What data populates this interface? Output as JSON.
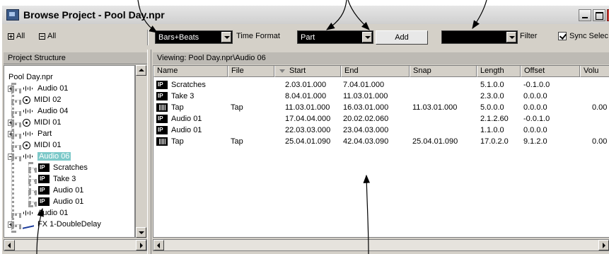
{
  "window": {
    "title": "Browse Project - Pool Day.npr"
  },
  "toolbar": {
    "expand_all": "All",
    "collapse_all": "All",
    "time_format_value": "Bars+Beats",
    "time_format_label": "Time Format",
    "type_value": "Part",
    "add_label": "Add",
    "filter_value": "",
    "filter_label": "Filter",
    "sync_label": "Sync Selec"
  },
  "left_panel": {
    "header": "Project Structure",
    "tree": [
      {
        "label": "Pool Day.npr",
        "icon": "",
        "depth": 0,
        "expander": "",
        "selected": false
      },
      {
        "label": "Audio 01",
        "icon": "audio-waveform-icon",
        "depth": 1,
        "expander": "plus",
        "selected": false
      },
      {
        "label": "MIDI 02",
        "icon": "midi-icon",
        "depth": 1,
        "expander": "",
        "selected": false
      },
      {
        "label": "Audio 04",
        "icon": "audio-waveform-icon",
        "depth": 1,
        "expander": "",
        "selected": false
      },
      {
        "label": "MIDI 01",
        "icon": "midi-icon",
        "depth": 1,
        "expander": "plus",
        "selected": false
      },
      {
        "label": "Part",
        "icon": "audio-waveform-icon",
        "depth": 1,
        "expander": "plus",
        "selected": false
      },
      {
        "label": "MIDI 01",
        "icon": "midi-icon",
        "depth": 1,
        "expander": "",
        "selected": false
      },
      {
        "label": "Audio 06",
        "icon": "audio-waveform-icon",
        "depth": 1,
        "expander": "minus",
        "selected": true
      },
      {
        "label": "Scratches",
        "icon": "audio-event-icon",
        "depth": 2,
        "expander": "",
        "selected": false
      },
      {
        "label": "Take 3",
        "icon": "audio-event-icon",
        "depth": 2,
        "expander": "",
        "selected": false
      },
      {
        "label": "Audio 01",
        "icon": "audio-event-icon",
        "depth": 2,
        "expander": "",
        "selected": false
      },
      {
        "label": "Audio 01",
        "icon": "audio-event-icon",
        "depth": 2,
        "expander": "",
        "selected": false
      },
      {
        "label": "Audio 01",
        "icon": "audio-waveform-icon",
        "depth": 1,
        "expander": "",
        "selected": false
      },
      {
        "label": "FX 1-DoubleDelay",
        "icon": "fx-curve-icon",
        "depth": 1,
        "expander": "plus",
        "selected": false
      }
    ]
  },
  "right_panel": {
    "viewing": "Viewing: Pool Day.npr\\Audio 06",
    "columns": [
      "Name",
      "File",
      "Start",
      "End",
      "Snap",
      "Length",
      "Offset",
      "Volu"
    ],
    "rows": [
      {
        "icon": "audio-event-icon",
        "name": "Scratches",
        "file": "",
        "start": "2.03.01.000",
        "end": "7.04.01.000",
        "snap": "",
        "length": "5.1.0.0",
        "offset": "-0.1.0.0",
        "volume": ""
      },
      {
        "icon": "audio-event-icon",
        "name": "Take 3",
        "file": "",
        "start": "8.04.01.000",
        "end": "11.03.01.000",
        "snap": "",
        "length": "2.3.0.0",
        "offset": "0.0.0.0",
        "volume": ""
      },
      {
        "icon": "audio-part-icon",
        "name": "Tap",
        "file": "Tap",
        "start": "11.03.01.000",
        "end": "16.03.01.000",
        "snap": "11.03.01.000",
        "length": "5.0.0.0",
        "offset": "0.0.0.0",
        "volume": "0.00"
      },
      {
        "icon": "audio-event-icon",
        "name": "Audio 01",
        "file": "",
        "start": "17.04.04.000",
        "end": "20.02.02.060",
        "snap": "",
        "length": "2.1.2.60",
        "offset": "-0.0.1.0",
        "volume": ""
      },
      {
        "icon": "audio-event-icon",
        "name": "Audio 01",
        "file": "",
        "start": "22.03.03.000",
        "end": "23.04.03.000",
        "snap": "",
        "length": "1.1.0.0",
        "offset": "0.0.0.0",
        "volume": ""
      },
      {
        "icon": "audio-part-icon",
        "name": "Tap",
        "file": "Tap",
        "start": "25.04.01.090",
        "end": "42.04.03.090",
        "snap": "25.04.01.090",
        "length": "17.0.2.0",
        "offset": "9.1.2.0",
        "volume": "0.00"
      }
    ]
  }
}
